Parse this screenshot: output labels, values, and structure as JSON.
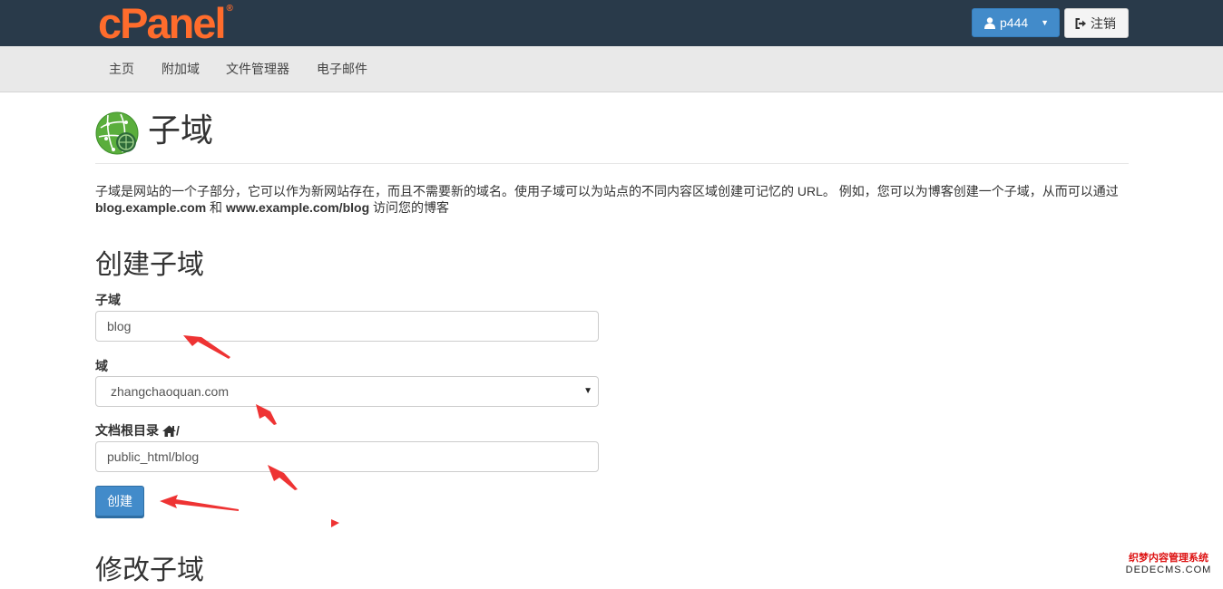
{
  "header": {
    "logo_text": "cPanel",
    "logo_reg": "®",
    "user_label": "p444",
    "logout_label": "注销"
  },
  "nav": {
    "items": [
      "主页",
      "附加域",
      "文件管理器",
      "电子邮件"
    ]
  },
  "page": {
    "title": "子域",
    "description_part1": "子域是网站的一个子部分，它可以作为新网站存在，而且不需要新的域名。使用子域可以为站点的不同内容区域创建可记忆的 URL。 例如，您可以为博客创建一个子域，从而可以通过",
    "description_bold1": "blog.example.com",
    "description_and": " 和 ",
    "description_bold2": "www.example.com/blog",
    "description_part2": " 访问您的博客"
  },
  "create": {
    "title": "创建子域",
    "subdomain_label": "子域",
    "subdomain_value": "blog",
    "domain_label": "域",
    "domain_value": "zhangchaoquan.com",
    "docroot_label": "文档根目录",
    "docroot_suffix": "/",
    "docroot_value": "public_html/blog",
    "create_button": "创建"
  },
  "modify": {
    "title": "修改子域"
  },
  "watermark": {
    "line1": "织梦内容管理系统",
    "line2": "DEDECMS.COM"
  },
  "colors": {
    "topbar": "#293a4a",
    "brand": "#ff6c2c",
    "primary": "#428bca",
    "annotation": "#ee3333"
  }
}
